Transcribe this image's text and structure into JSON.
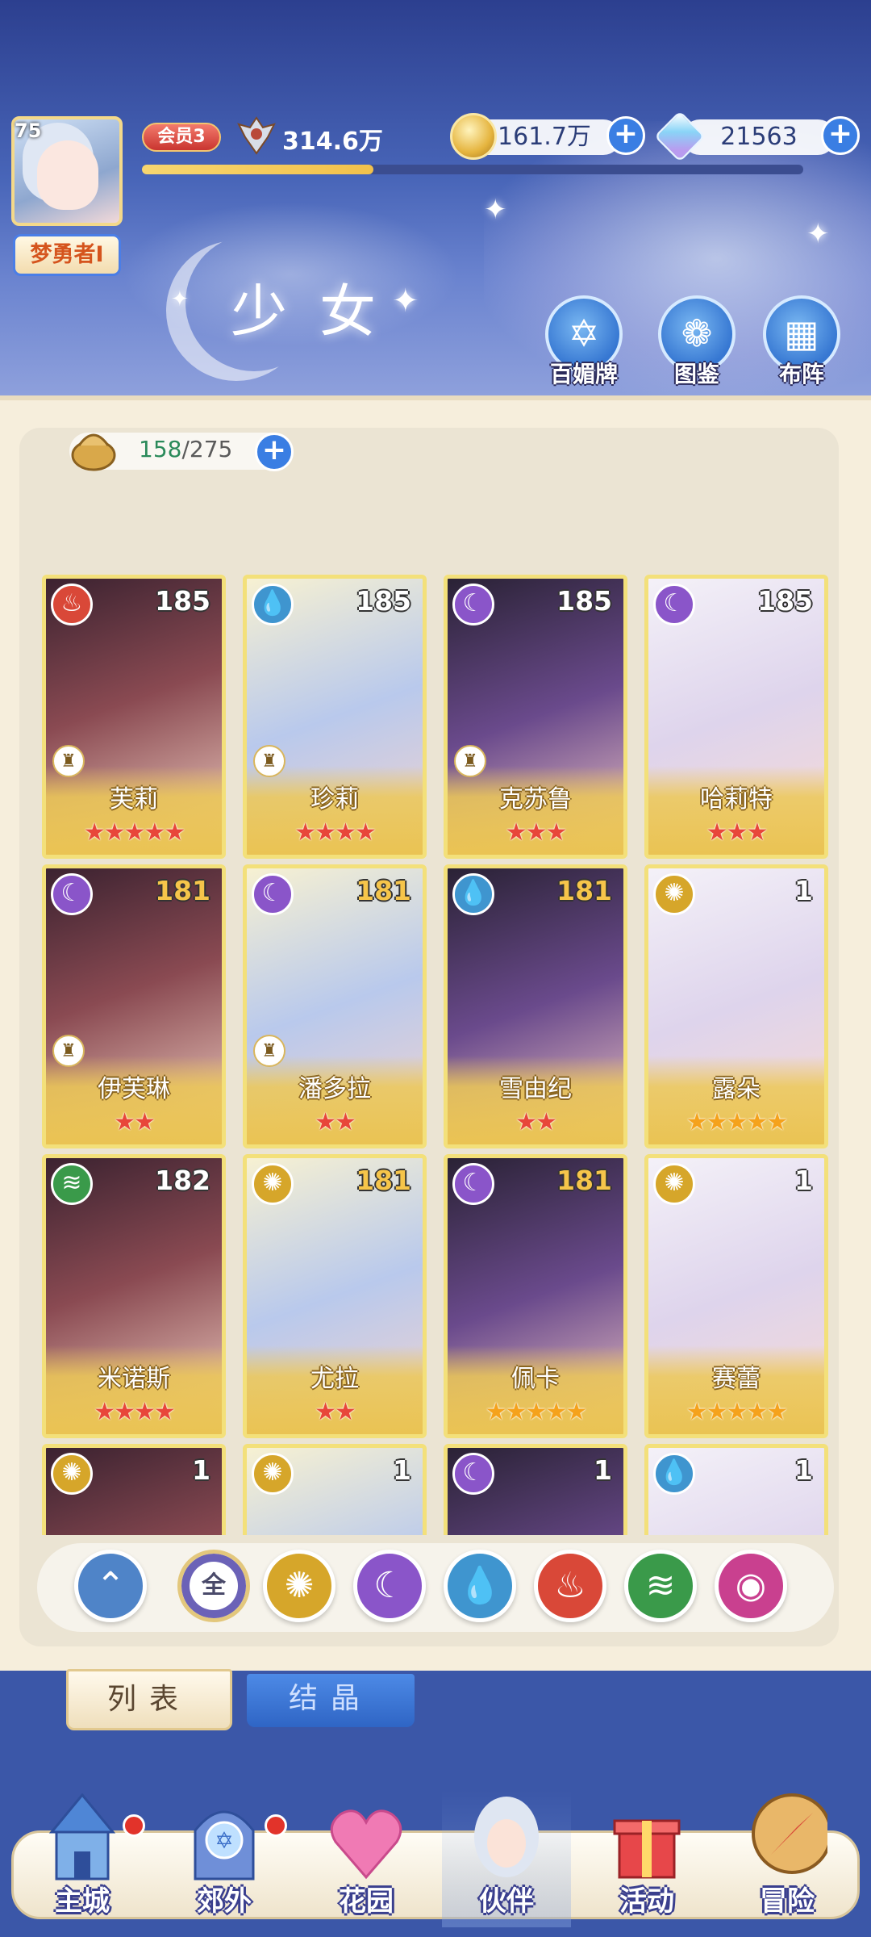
{
  "player": {
    "level": "75",
    "name": "梦勇者I",
    "vip": "会员3",
    "power": "314.6万",
    "exp_fraction": 0.35
  },
  "resources": {
    "coins": "161.7万",
    "gems": "21563"
  },
  "page_title": "少女",
  "top_buttons": [
    "百媚牌",
    "图鉴",
    "布阵"
  ],
  "roster_count": {
    "current": "158",
    "total": "/275"
  },
  "cards": [
    {
      "name": "芙莉",
      "level": "185",
      "element": "fire",
      "stars": "★★★★★",
      "star_color": "red",
      "rank": true
    },
    {
      "name": "珍莉",
      "level": "185",
      "element": "water",
      "stars": "★★★★",
      "star_color": "red",
      "rank": true
    },
    {
      "name": "克苏鲁",
      "level": "185",
      "element": "moon",
      "stars": "★★★",
      "star_color": "red",
      "rank": true
    },
    {
      "name": "哈莉特",
      "level": "185",
      "element": "moon",
      "stars": "★★★",
      "star_color": "red",
      "rank": false
    },
    {
      "name": "伊芙琳",
      "level": "181",
      "element": "moon",
      "stars": "★★",
      "star_color": "red",
      "rank": true,
      "level_gold": true
    },
    {
      "name": "潘多拉",
      "level": "181",
      "element": "moon",
      "stars": "★★",
      "star_color": "red",
      "rank": true,
      "level_gold": true
    },
    {
      "name": "雪由纪",
      "level": "181",
      "element": "water",
      "stars": "★★",
      "star_color": "red",
      "rank": false,
      "level_gold": true
    },
    {
      "name": "露朵",
      "level": "1",
      "element": "sun",
      "stars": "★★★★★",
      "star_color": "gold",
      "rank": false
    },
    {
      "name": "米诺斯",
      "level": "182",
      "element": "wind",
      "stars": "★★★★",
      "star_color": "red",
      "rank": false
    },
    {
      "name": "尤拉",
      "level": "181",
      "element": "sun",
      "stars": "★★",
      "star_color": "red",
      "rank": false,
      "level_gold": true
    },
    {
      "name": "佩卡",
      "level": "181",
      "element": "moon",
      "stars": "★★★★★",
      "star_color": "gold",
      "rank": false,
      "level_gold": true
    },
    {
      "name": "赛蕾",
      "level": "1",
      "element": "sun",
      "stars": "★★★★★",
      "star_color": "gold",
      "rank": false
    },
    {
      "name": "",
      "level": "1",
      "element": "sun",
      "stars": "",
      "star_color": "gold",
      "rank": false
    },
    {
      "name": "",
      "level": "1",
      "element": "sun",
      "stars": "",
      "star_color": "gold",
      "rank": false
    },
    {
      "name": "",
      "level": "1",
      "element": "moon",
      "stars": "",
      "star_color": "gold",
      "rank": false
    },
    {
      "name": "",
      "level": "1",
      "element": "water",
      "stars": "",
      "star_color": "gold",
      "rank": false
    }
  ],
  "filters": {
    "all_label": "全",
    "icons": [
      "class-icon",
      "all",
      "sun-icon",
      "moon-icon",
      "water-icon",
      "fire-icon",
      "wind-icon",
      "orb-icon"
    ]
  },
  "tabs": {
    "list": "列表",
    "crystal": "结晶"
  },
  "bottom_nav": [
    "主城",
    "郊外",
    "花园",
    "伙伴",
    "活动",
    "冒险"
  ],
  "colors": {
    "accent_blue": "#3a7ee3",
    "card_gold": "#e7b93a",
    "panel_bg": "#f6eedc"
  }
}
